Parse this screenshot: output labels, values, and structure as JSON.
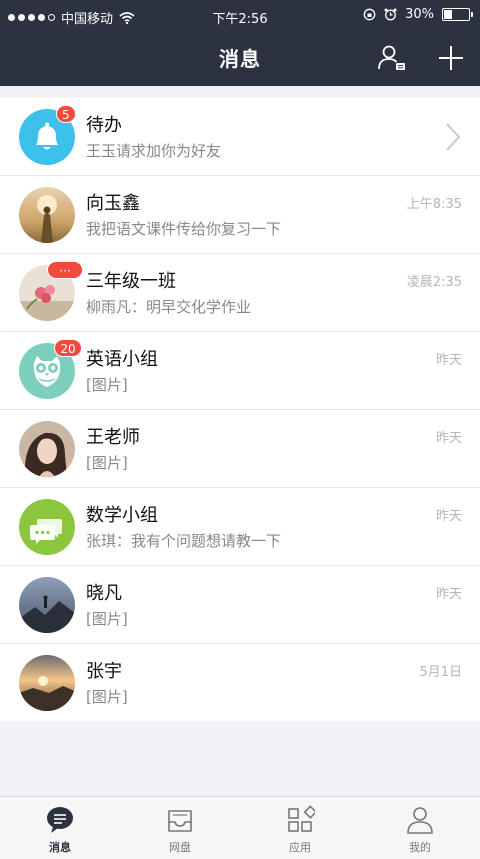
{
  "status_bar": {
    "carrier": "中国移动",
    "time": "下午2:56",
    "battery": "30%"
  },
  "header": {
    "title": "消息"
  },
  "conversations": [
    {
      "name": "待办",
      "preview": "王玉请求加你为好友",
      "time": "",
      "badge": "5",
      "avatar": "bell-icon"
    },
    {
      "name": "向玉鑫",
      "preview": "我把语文课件传给你复习一下",
      "time": "上午8:35",
      "badge": "",
      "avatar": "photo-person-field"
    },
    {
      "name": "三年级一班",
      "preview": "柳雨凡：明早交化学作业",
      "time": "凌晨2:35",
      "badge": "···",
      "avatar": "photo-flowers"
    },
    {
      "name": "英语小组",
      "preview": "[图片]",
      "time": "昨天",
      "badge": "20",
      "avatar": "owl-icon"
    },
    {
      "name": "王老师",
      "preview": "[图片]",
      "time": "昨天",
      "badge": "",
      "avatar": "photo-woman"
    },
    {
      "name": "数学小组",
      "preview": "张琪：我有个问题想请教一下",
      "time": "昨天",
      "badge": "",
      "avatar": "chat-bubbles-icon"
    },
    {
      "name": "晓凡",
      "preview": "[图片]",
      "time": "昨天",
      "badge": "",
      "avatar": "photo-mountain"
    },
    {
      "name": "张宇",
      "preview": "[图片]",
      "time": "5月1日",
      "badge": "",
      "avatar": "photo-sunset"
    }
  ],
  "tabbar": {
    "items": [
      {
        "label": "消息",
        "icon": "message-icon",
        "active": true
      },
      {
        "label": "网盘",
        "icon": "inbox-tray-icon",
        "active": false
      },
      {
        "label": "应用",
        "icon": "apps-grid-icon",
        "active": false
      },
      {
        "label": "我的",
        "icon": "person-icon",
        "active": false
      }
    ]
  },
  "colors": {
    "header_bg": "#2d3240",
    "badge": "#f24a3d",
    "bell_avatar": "#3ec0ec",
    "owl_avatar": "#7dcfbd",
    "chat_avatar": "#8cc63e"
  }
}
